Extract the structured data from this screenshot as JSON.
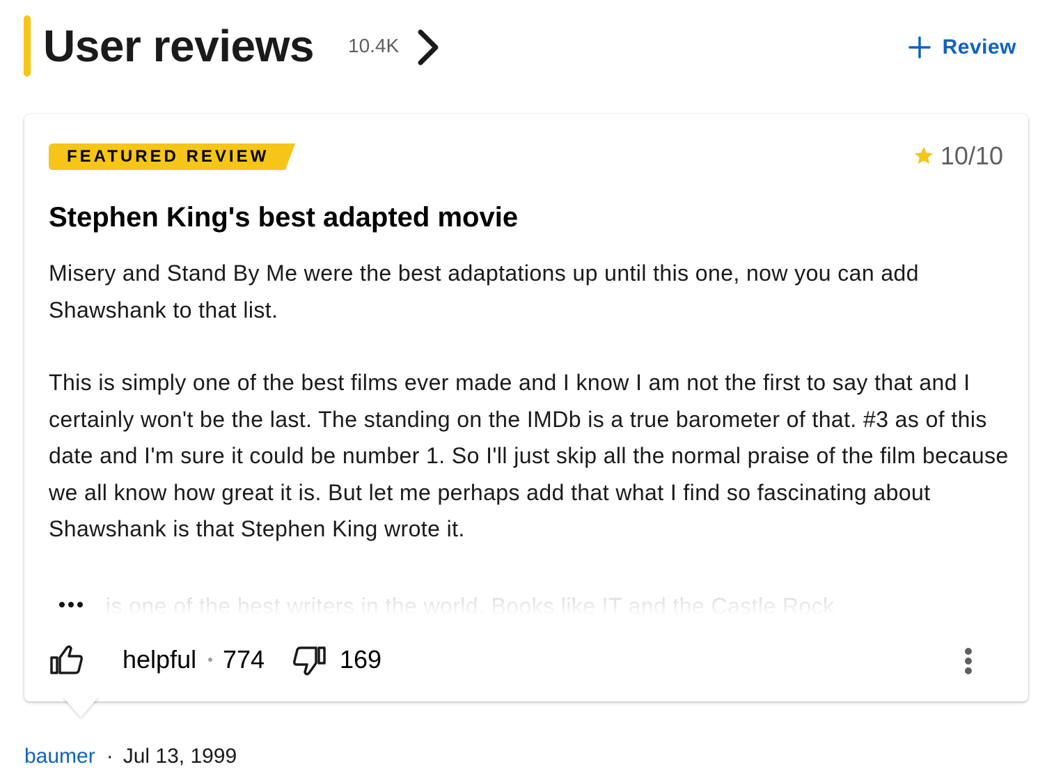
{
  "header": {
    "title": "User reviews",
    "count": "10.4K",
    "add_review_label": "Review"
  },
  "review": {
    "badge": "FEATURED REVIEW",
    "rating": "10/10",
    "title": "Stephen King's best adapted movie",
    "paragraphs": [
      "Misery and Stand By Me were the best adaptations up until this one, now you can add Shawshank to that list.",
      "This is simply one of the best films ever made and I know I am not the first to say that and I certainly won't be the last. The standing on the IMDb is a true barometer of that. #3 as of this date and I'm sure it could be number 1. So I'll just skip all the normal praise of the film because we all know how great it is. But let me perhaps add that what I find so fascinating about Shawshank is that Stephen King wrote it."
    ],
    "truncated_text": "is one of the best writers in the world. Books like IT and the Castle Rock",
    "helpful_label": "helpful",
    "helpful_count": "774",
    "unhelpful_count": "169",
    "author": "baumer",
    "separator": "·",
    "date": "Jul 13, 1999"
  },
  "colors": {
    "accent": "#f5c518",
    "link": "#0e63be",
    "muted": "#5f5f5f"
  },
  "icons": {
    "chevron": "chevron-right-icon",
    "add": "plus-icon",
    "star": "star-icon",
    "thumb_up": "thumb-up-icon",
    "thumb_down": "thumb-down-icon",
    "more": "more-vertical-icon",
    "expand": "ellipsis-icon"
  }
}
